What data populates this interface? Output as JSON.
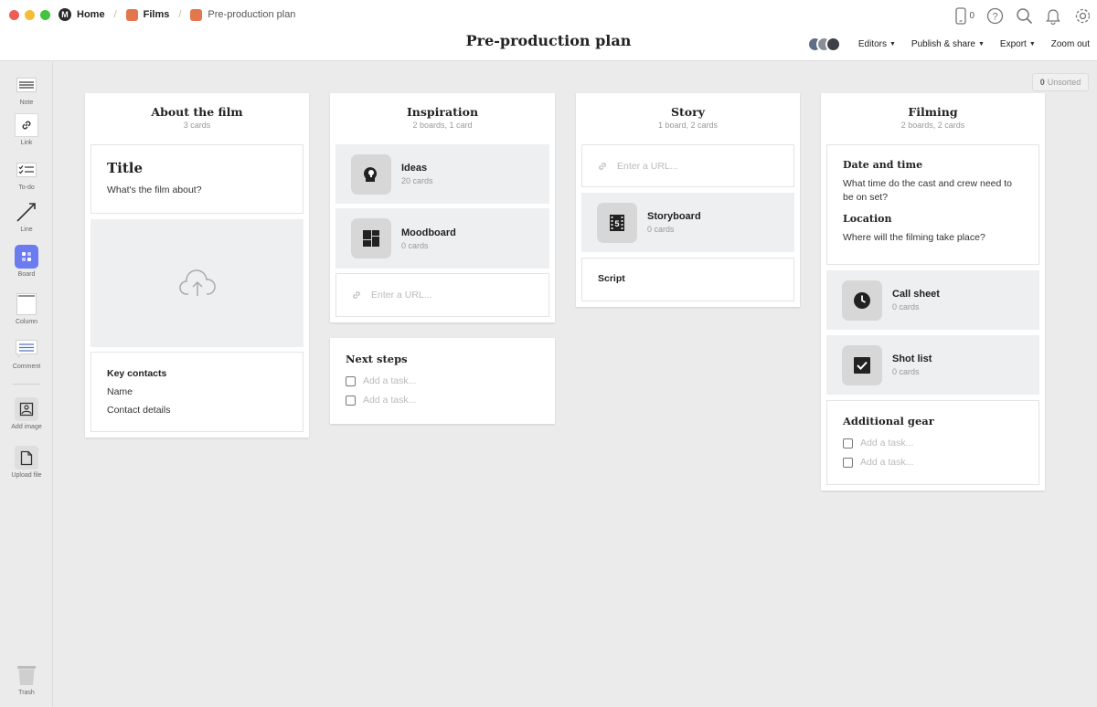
{
  "breadcrumb": {
    "home": "Home",
    "films": "Films",
    "current": "Pre-production plan"
  },
  "header": {
    "title": "Pre-production plan",
    "phone_count": "0",
    "editors": "Editors",
    "publish": "Publish & share",
    "export": "Export",
    "zoom": "Zoom out"
  },
  "colors": {
    "traffic_red": "#ee5e56",
    "traffic_yellow": "#f5bd37",
    "traffic_green": "#44c43e",
    "board_orange": "#e3764c",
    "accent_board": "#6b7bf0"
  },
  "sidebar": {
    "note": "Note",
    "link": "Link",
    "todo": "To-do",
    "line": "Line",
    "board": "Board",
    "column": "Column",
    "comment": "Comment",
    "add_image": "Add image",
    "upload_file": "Upload file",
    "trash": "Trash"
  },
  "unsorted": {
    "count": "0",
    "label": "Unsorted"
  },
  "columns": {
    "about": {
      "title": "About the film",
      "subtitle": "3 cards",
      "title_card": {
        "title": "Title",
        "text": "What's the film about?"
      },
      "contacts": {
        "heading": "Key contacts",
        "name": "Name",
        "details": "Contact details"
      }
    },
    "inspiration": {
      "title": "Inspiration",
      "subtitle": "2 boards, 1 card",
      "ideas": {
        "name": "Ideas",
        "count": "20 cards"
      },
      "moodboard": {
        "name": "Moodboard",
        "count": "0 cards"
      },
      "url_placeholder": "Enter a URL..."
    },
    "next_steps": {
      "title": "Next steps",
      "task1": "Add a task...",
      "task2": "Add a task..."
    },
    "story": {
      "title": "Story",
      "subtitle": "1 board, 2 cards",
      "url_placeholder": "Enter a URL...",
      "storyboard": {
        "name": "Storyboard",
        "count": "0 cards"
      },
      "script": "Script"
    },
    "filming": {
      "title": "Filming",
      "subtitle": "2 boards, 2 cards",
      "date_heading": "Date and time",
      "date_text": "What time do the cast and crew need to be on set?",
      "location_heading": "Location",
      "location_text": "Where will the filming take place?",
      "call_sheet": {
        "name": "Call sheet",
        "count": "0 cards"
      },
      "shot_list": {
        "name": "Shot list",
        "count": "0 cards"
      },
      "gear": {
        "title": "Additional gear",
        "task1": "Add a task...",
        "task2": "Add a task..."
      }
    }
  }
}
